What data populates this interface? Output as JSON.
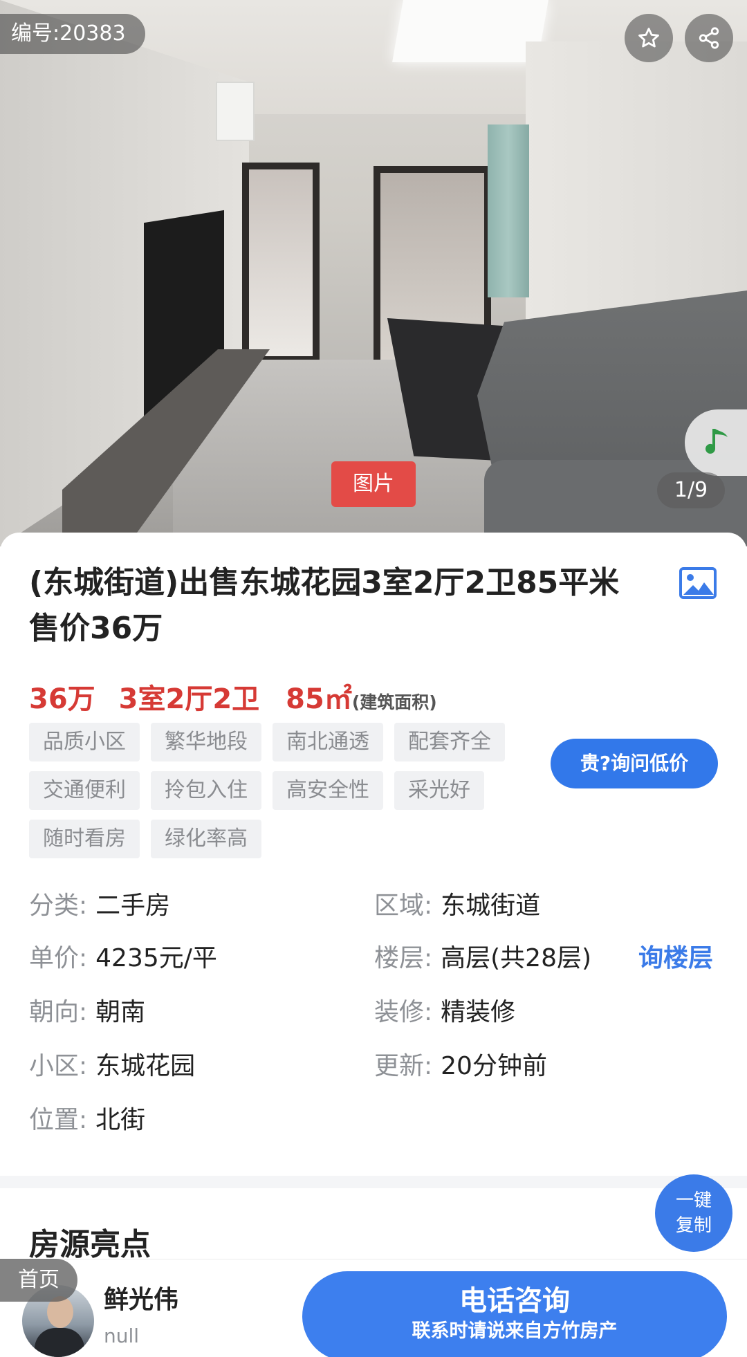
{
  "hero": {
    "listing_id": "编号:20383",
    "media_tag": "图片",
    "counter": "1/9",
    "icons": {
      "favorite": "star-icon",
      "share": "share-icon",
      "music": "music-note-icon"
    }
  },
  "listing": {
    "title": "(东城街道)出售东城花园3室2厅2卫85平米 售价36万",
    "price": "36万",
    "layout": "3室2厅2卫",
    "area": "85㎡",
    "area_note": "(建筑面积)",
    "tags": [
      "品质小区",
      "繁华地段",
      "南北通透",
      "配套齐全",
      "交通便利",
      "拎包入住",
      "高安全性",
      "采光好",
      "随时看房",
      "绿化率高"
    ],
    "ask_button": "贵?询问低价",
    "image_icon": "image-icon"
  },
  "details": {
    "category_label": "分类:",
    "category_value": "二手房",
    "district_label": "区域:",
    "district_value": "东城街道",
    "unit_price_label": "单价:",
    "unit_price_value": "4235元/平",
    "floor_label": "楼层:",
    "floor_value": "高层(共28层)",
    "floor_link": "询楼层",
    "orientation_label": "朝向:",
    "orientation_value": "朝南",
    "decoration_label": "装修:",
    "decoration_value": "精装修",
    "community_label": "小区:",
    "community_value": "东城花园",
    "updated_label": "更新:",
    "updated_value": "20分钟前",
    "location_label": "位置:",
    "location_value": "北街"
  },
  "highlights": {
    "title": "房源亮点"
  },
  "copy_button": {
    "line1": "一键",
    "line2": "复制"
  },
  "bottom_bar": {
    "home_label": "首页",
    "agent_name": "鲜光伟",
    "agent_sub": "null",
    "call_title": "电话咨询",
    "call_subtitle": "联系时请说来自方竹房产"
  },
  "colors": {
    "accent_blue": "#3d7fee",
    "price_red": "#d63a35",
    "media_tag_red": "#e34b47"
  }
}
